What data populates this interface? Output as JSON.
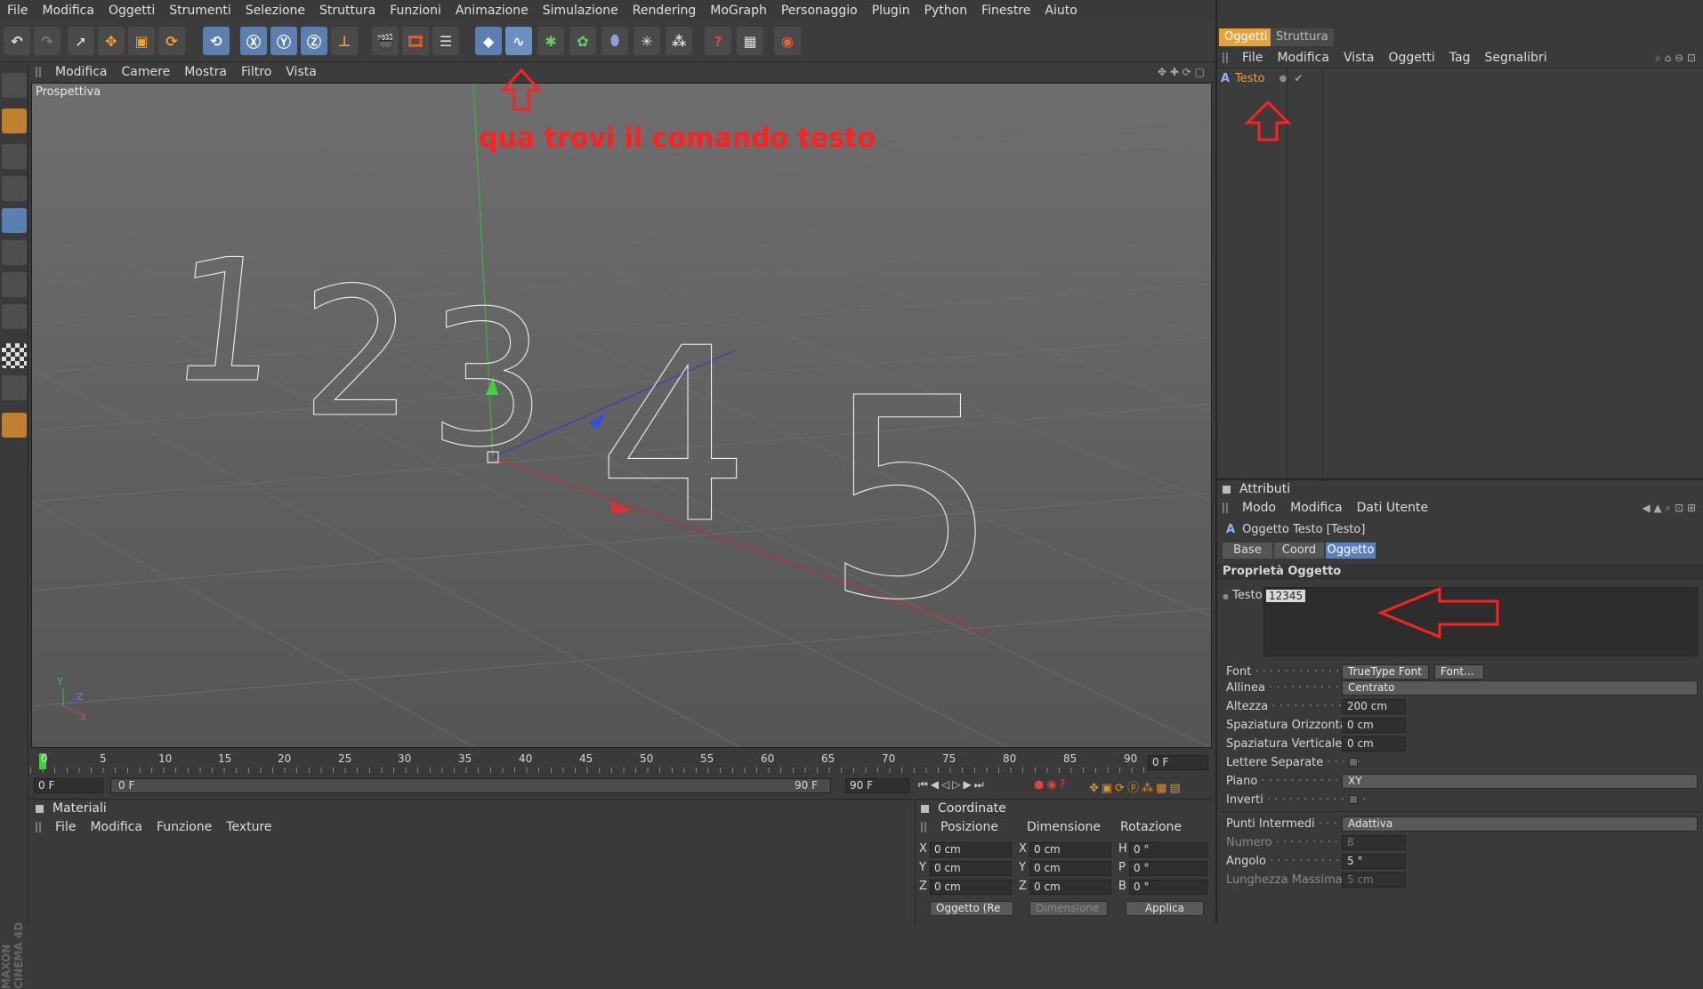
{
  "menubar": {
    "items": [
      "File",
      "Modifica",
      "Oggetti",
      "Strumenti",
      "Selezione",
      "Struttura",
      "Funzioni",
      "Animazione",
      "Simulazione",
      "Rendering",
      "MoGraph",
      "Personaggio",
      "Plugin",
      "Python",
      "Finestre",
      "Aiuto"
    ]
  },
  "viewport": {
    "menu": [
      "Modifica",
      "Camere",
      "Mostra",
      "Filtro",
      "Vista"
    ],
    "label": "Prospettiva",
    "annotation": "qua trovi il comando testo",
    "digits": [
      "1",
      "2",
      "3",
      "4",
      "5"
    ],
    "axis_labels": {
      "y": "Y",
      "z": "Z",
      "x": "X"
    }
  },
  "timeline": {
    "ticks": [
      "0",
      "5",
      "10",
      "15",
      "20",
      "25",
      "30",
      "35",
      "40",
      "45",
      "50",
      "55",
      "60",
      "65",
      "70",
      "75",
      "80",
      "85",
      "90"
    ],
    "current_frame": "0 F",
    "start_frame": "0 F",
    "range_start": "0 F",
    "range_end": "90 F",
    "end_frame": "90 F"
  },
  "materials": {
    "title": "Materiali",
    "menu": [
      "File",
      "Modifica",
      "Funzione",
      "Texture"
    ]
  },
  "coordinates": {
    "title": "Coordinate",
    "headers": [
      "Posizione",
      "Dimensione",
      "Rotazione"
    ],
    "rows": [
      {
        "a": "X",
        "pos": "0 cm",
        "b": "X",
        "dim": "0 cm",
        "c": "H",
        "rot": "0 °"
      },
      {
        "a": "Y",
        "pos": "0 cm",
        "b": "Y",
        "dim": "0 cm",
        "c": "P",
        "rot": "0 °"
      },
      {
        "a": "Z",
        "pos": "0 cm",
        "b": "Z",
        "dim": "0 cm",
        "c": "B",
        "rot": "0 °"
      }
    ],
    "mode_dropdown": "Oggetto (Re",
    "size_dropdown": "Dimensione",
    "apply_label": "Applica"
  },
  "objects_panel": {
    "tabs": [
      "Oggetti",
      "Struttura"
    ],
    "menu": [
      "File",
      "Modifica",
      "Vista",
      "Oggetti",
      "Tag",
      "Segnalibri"
    ],
    "object_name": "Testo"
  },
  "attributes": {
    "title": "Attributi",
    "menu": [
      "Modo",
      "Modifica",
      "Dati Utente"
    ],
    "object_title": "Oggetto Testo [Testo]",
    "tabs": [
      "Base",
      "Coord",
      "Oggetto"
    ],
    "section": "Proprietà Oggetto",
    "text_label": "Testo",
    "text_value": "12345",
    "fields": {
      "font_label": "Font",
      "font_value": "TrueType Font",
      "font_button": "Font...",
      "align_label": "Allinea",
      "align_value": "Centrato",
      "height_label": "Altezza",
      "height_value": "200 cm",
      "hspacing_label": "Spaziatura Orizzontale",
      "hspacing_value": "0 cm",
      "vspacing_label": "Spaziatura Verticale",
      "vspacing_value": "0 cm",
      "separate_label": "Lettere Separate",
      "plane_label": "Piano",
      "plane_value": "XY",
      "invert_label": "Inverti",
      "intermediate_label": "Punti Intermedi",
      "intermediate_value": "Adattiva",
      "number_label": "Numero",
      "number_value": "8",
      "angle_label": "Angolo",
      "angle_value": "5 °",
      "maxlen_label": "Lunghezza Massima",
      "maxlen_value": "5 cm"
    }
  },
  "brand": "MAXON CINEMA 4D",
  "colors": {
    "accent": "#e8a23a",
    "annotation": "#ff2020",
    "selected_tab": "#5a80c0"
  }
}
